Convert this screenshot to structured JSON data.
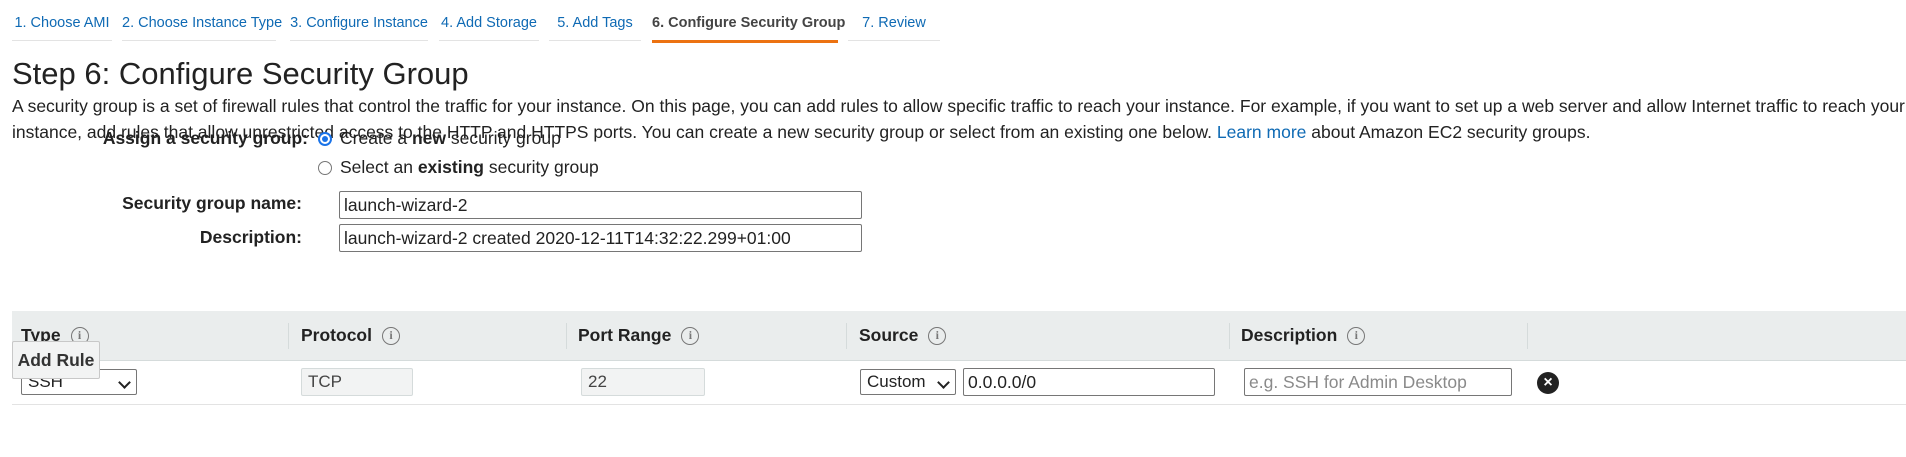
{
  "tabs": [
    {
      "label": "1. Choose AMI"
    },
    {
      "label": "2. Choose Instance Type"
    },
    {
      "label": "3. Configure Instance"
    },
    {
      "label": "4. Add Storage"
    },
    {
      "label": "5. Add Tags"
    },
    {
      "label": "6. Configure Security Group",
      "active": true
    },
    {
      "label": "7. Review"
    }
  ],
  "heading": "Step 6: Configure Security Group",
  "intro": {
    "line1": "A security group is a set of firewall rules that control the traffic for your instance. On this page, you can add rules to allow specific traffic to reach your instance. For example, if you want to set up a web server and allow Internet traffic to reach your",
    "line2_start": "instance, add rules that allow unrestricted access to the HTTP and HTTPS ports. You can create a new security group or select from an existing one below.",
    "link": "Learn more",
    "line2_end": "about Amazon EC2 security groups."
  },
  "assign": {
    "label": "Assign a security group:",
    "option_new": {
      "pre": "Create a ",
      "bold": "new",
      "post": " security group",
      "selected": true
    },
    "option_existing": {
      "pre": "Select an ",
      "bold": "existing",
      "post": " security group",
      "selected": false
    }
  },
  "group_name": {
    "label": "Security group name:",
    "value": "launch-wizard-2"
  },
  "description": {
    "label": "Description:",
    "value": "launch-wizard-2 created 2020-12-11T14:32:22.299+01:00"
  },
  "table": {
    "headers": {
      "type": "Type",
      "protocol": "Protocol",
      "port_range": "Port Range",
      "source": "Source",
      "description": "Description"
    },
    "rows": [
      {
        "type": "SSH",
        "protocol": "TCP",
        "port_range": "22",
        "source_mode": "Custom",
        "source_cidr": "0.0.0.0/0",
        "description_placeholder": "e.g. SSH for Admin Desktop"
      }
    ]
  },
  "add_rule_label": "Add Rule",
  "icons": {
    "info": "info-icon",
    "remove": "close-circle-icon",
    "dropdown": "chevron-down-icon"
  }
}
